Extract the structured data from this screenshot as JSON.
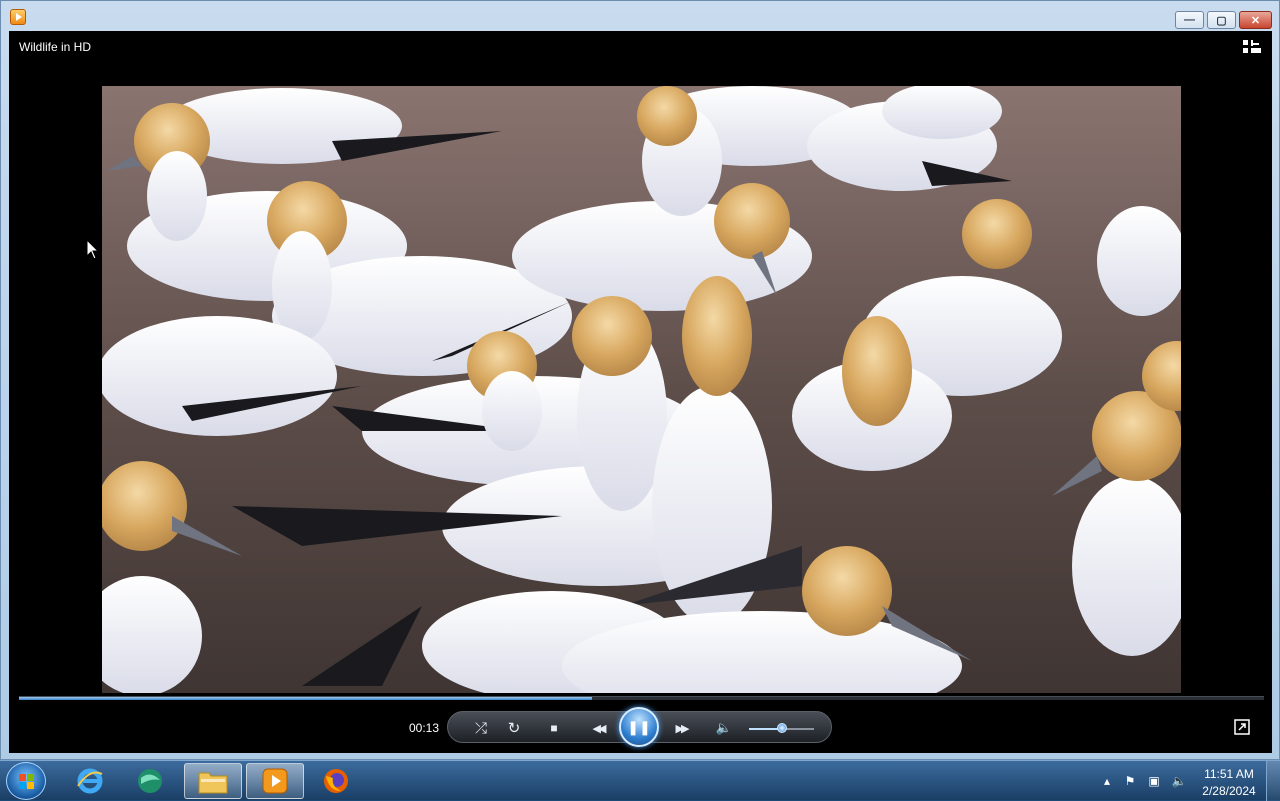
{
  "window": {
    "title": "",
    "controls": {
      "minimize": "—",
      "maximize": "▢",
      "close": "✕"
    }
  },
  "player": {
    "media_title": "Wildlife in HD",
    "elapsed_time": "00:13",
    "progress_fraction": 0.46,
    "volume_fraction": 0.5,
    "state": "playing",
    "video_description_icon": "video-frame-gannet-colony",
    "icons": {
      "shuffle": "⤮",
      "repeat": "↻",
      "stop": "■",
      "previous": "◀◀",
      "pause": "❚❚",
      "next": "▶▶",
      "mute": "🔈",
      "switch_to_library": "switch-to-library-icon",
      "switch_to_now_playing": "switch-to-now-playing-icon"
    }
  },
  "taskbar": {
    "buttons": [
      {
        "name": "start-button",
        "icon": "windows-logo-icon"
      },
      {
        "name": "internet-explorer",
        "icon": "internet-explorer-icon"
      },
      {
        "name": "app-2",
        "icon": "app-globe-icon"
      },
      {
        "name": "windows-explorer",
        "icon": "folder-icon"
      },
      {
        "name": "windows-media-player",
        "icon": "media-player-icon"
      },
      {
        "name": "firefox",
        "icon": "firefox-icon"
      }
    ],
    "tray": {
      "time": "11:51 AM",
      "date": "2/28/2024"
    }
  },
  "colors": {
    "accent": "#3c82c6",
    "player_bg": "#000000",
    "taskbar": "#1a3f66"
  }
}
